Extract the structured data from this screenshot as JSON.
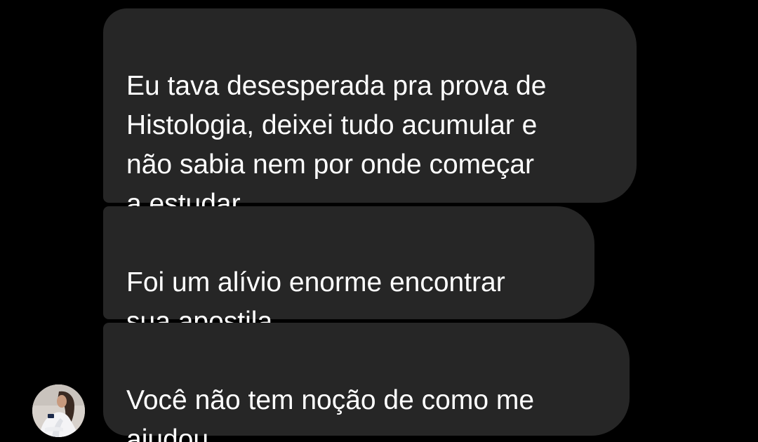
{
  "thread": {
    "messages": [
      {
        "text": "Eu tava desesperada pra prova de\nHistologia, deixei tudo acumular e\nnão sabia nem por onde começar\na estudar"
      },
      {
        "text": "Foi um alívio enorme encontrar\nsua apostila"
      },
      {
        "text": "Você não tem noção de como me\najudou"
      }
    ],
    "sender_avatar_icon": "user-avatar-photo",
    "colors": {
      "background": "#000000",
      "bubble": "#262626",
      "text": "#ffffff"
    }
  }
}
